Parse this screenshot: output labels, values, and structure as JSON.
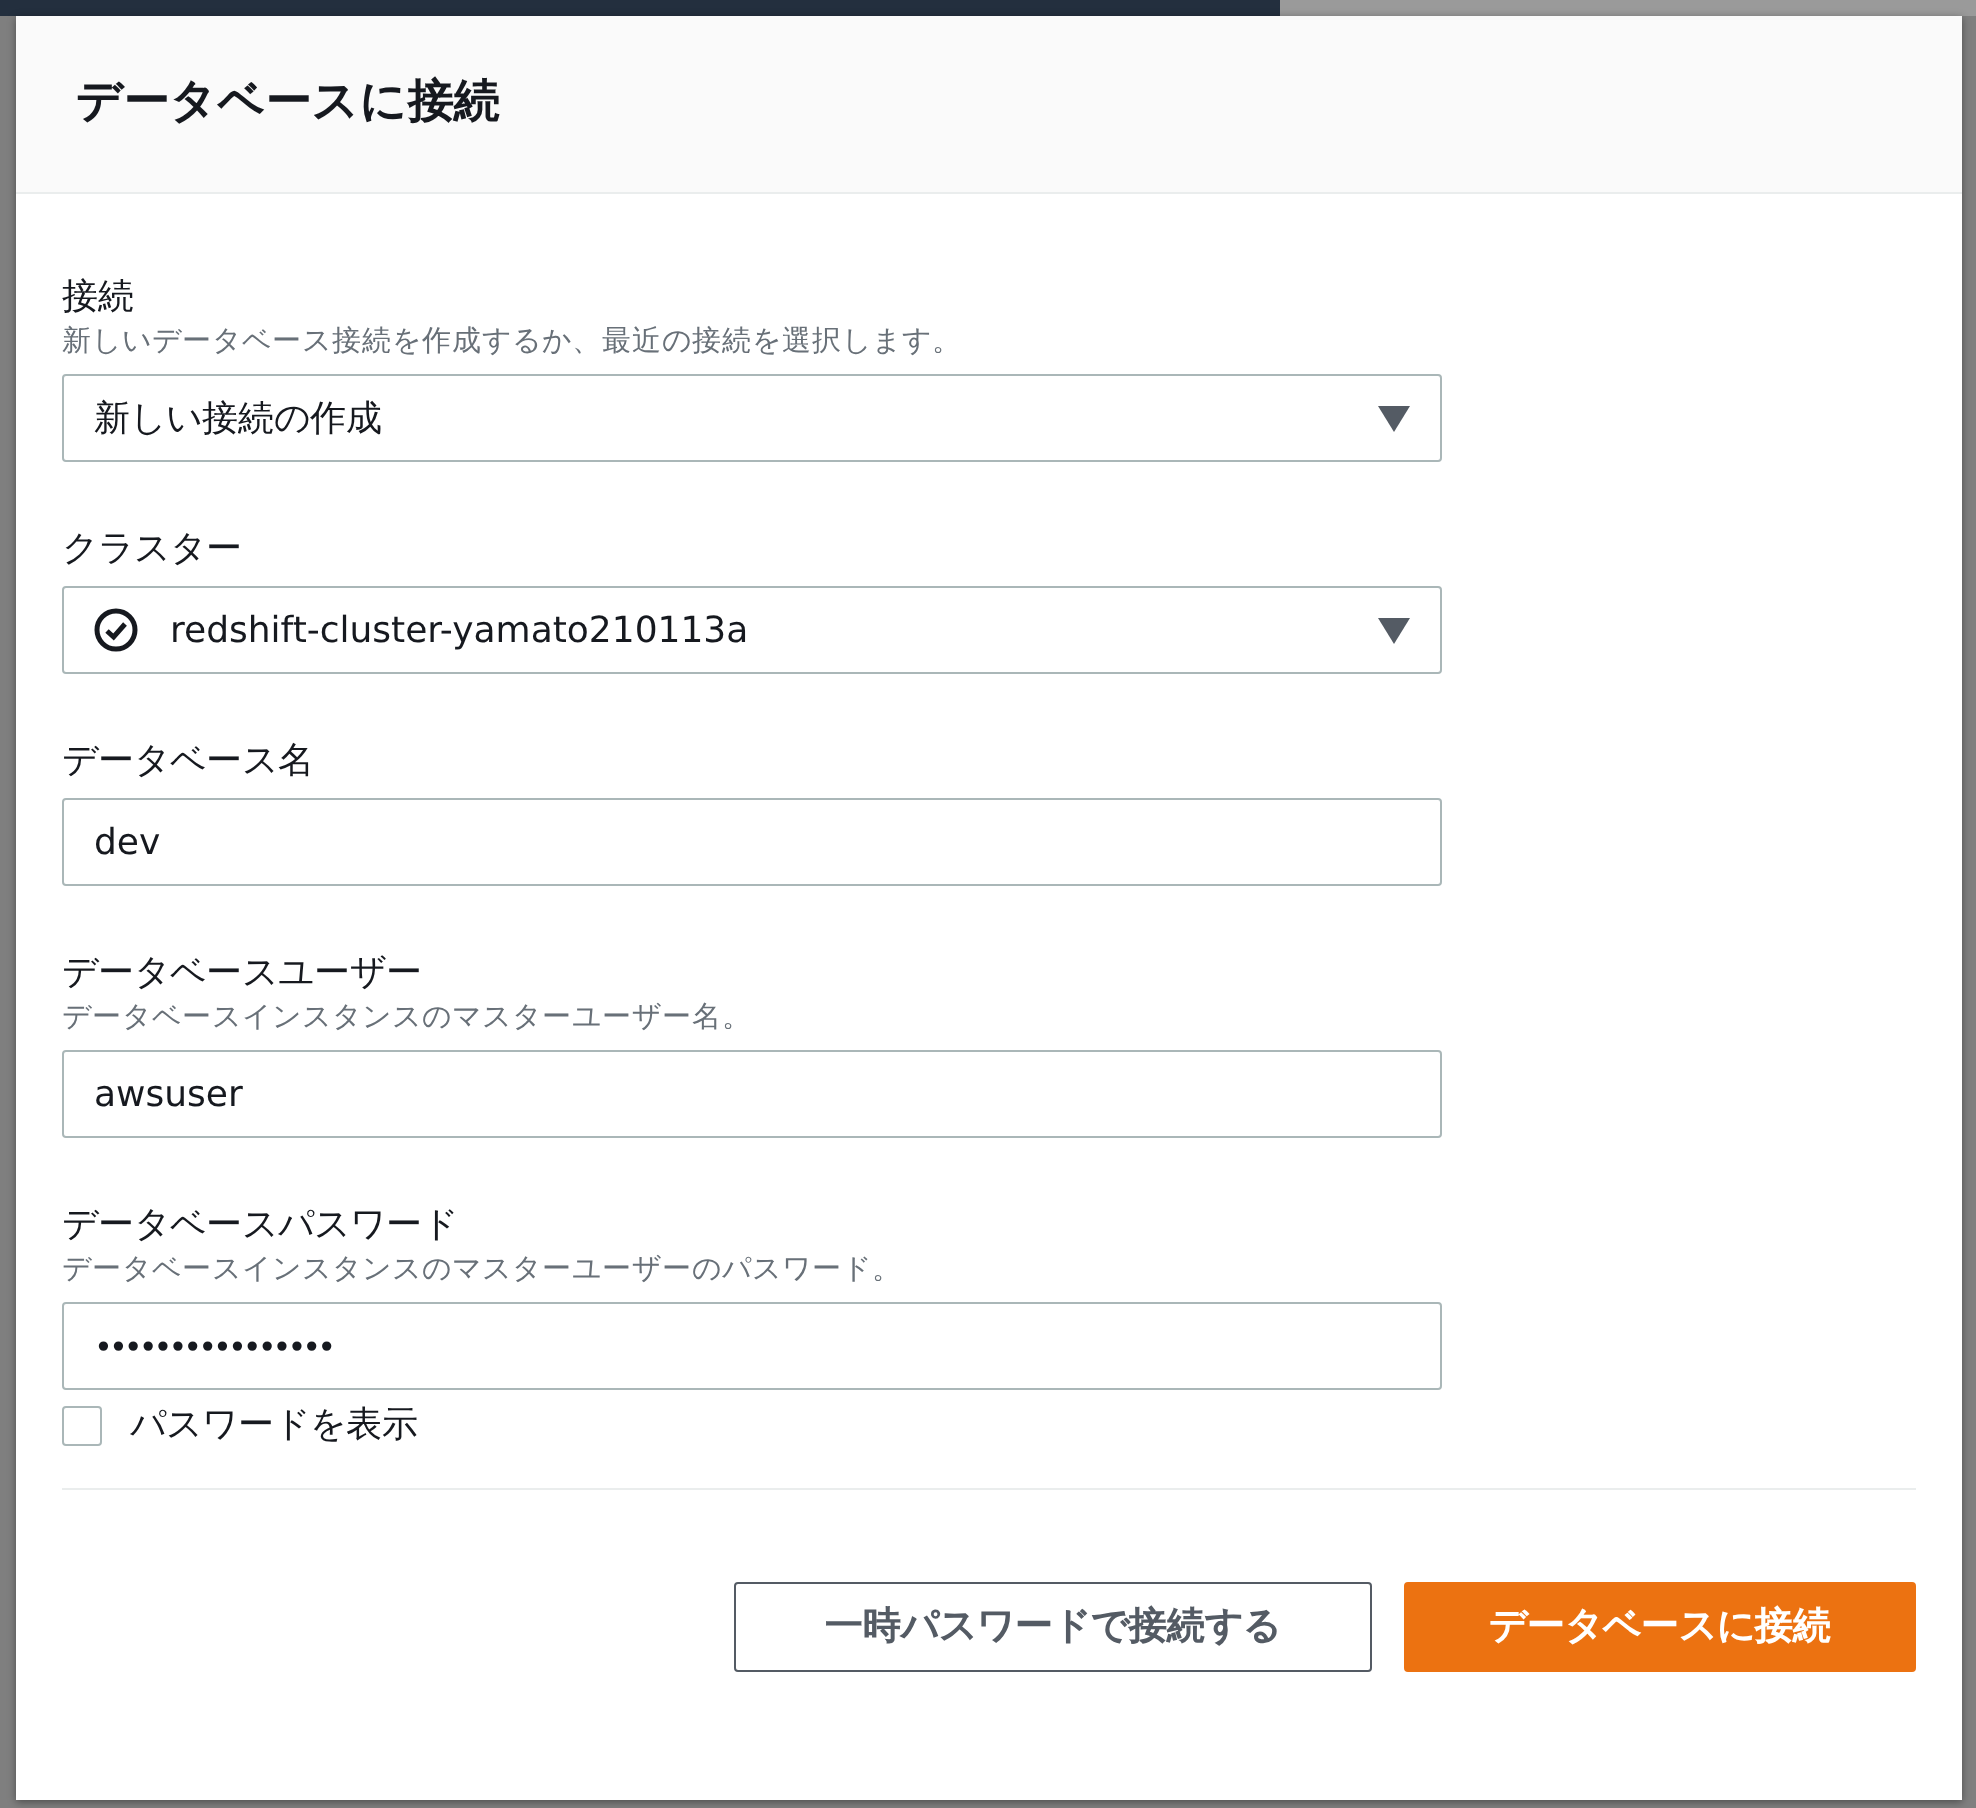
{
  "dialog": {
    "title": "データベースに接続"
  },
  "fields": [
    {
      "kind": "select",
      "label": "接続",
      "description": "新しいデータベース接続を作成するか、最近の接続を選択します。",
      "value": "新しい接続の作成"
    },
    {
      "kind": "status-select",
      "label": "クラスター",
      "value": "redshift-cluster-yamato210113a"
    },
    {
      "kind": "text",
      "label": "データベース名",
      "value": "dev"
    },
    {
      "kind": "text",
      "label": "データベースユーザー",
      "description": "データベースインスタンスのマスターユーザー名。",
      "value": "awsuser"
    },
    {
      "kind": "password",
      "label": "データベースパスワード",
      "description": "データベースインスタンスのマスターユーザーのパスワード。",
      "value": "••••••••••••••••"
    }
  ],
  "show_password": {
    "label": "パスワードを表示",
    "checked": false
  },
  "buttons": [
    {
      "kind": "secondary",
      "label": "一時パスワードで接続する"
    },
    {
      "kind": "primary",
      "label": "データベースに接続"
    }
  ]
}
